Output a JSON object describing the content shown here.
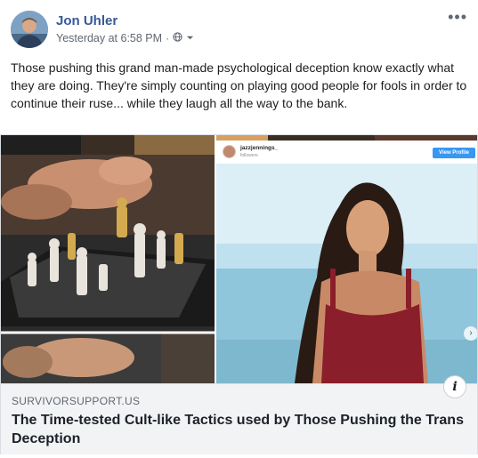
{
  "post": {
    "author": "Jon Uhler",
    "timestamp": "Yesterday at 6:58 PM",
    "meta_separator": "·",
    "audience_icon": "globe-icon",
    "audience_dropdown_icon": "caret-down-icon",
    "more_icon": "more-options-icon",
    "more_label": "•••",
    "body": "Those pushing this grand man-made psychological deception know exactly what they are doing. They're simply counting on playing good people for fools in order to continue their ruse... while they laugh all the way to the bank."
  },
  "link_preview": {
    "domain": "SURVIVORSUPPORT.US",
    "title": "The Time-tested Cult-like Tactics used by Those Pushing the Trans Deception",
    "info_label": "i",
    "embedded_instagram": {
      "username": "jazzjennings_",
      "subtext": "followers",
      "button_label": "View Profile"
    },
    "carousel_next_label": "›"
  },
  "colors": {
    "author_link": "#385898",
    "meta_text": "#606770",
    "caption_bg": "#f2f3f5",
    "instagram_blue": "#3897f0"
  }
}
